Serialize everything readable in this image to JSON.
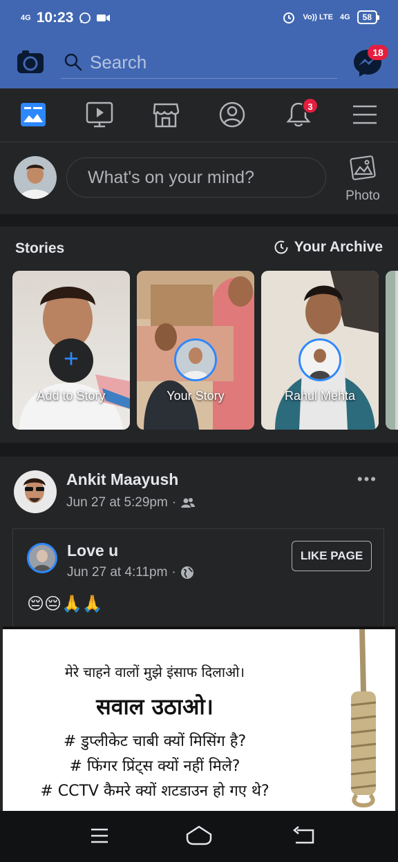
{
  "status_bar": {
    "network": "4G",
    "time": "10:23",
    "volte": "Vo)) LTE",
    "network2": "4G",
    "battery": "58"
  },
  "top_bar": {
    "search_placeholder": "Search",
    "messenger_badge": "18",
    "brand_color": "#4267b2"
  },
  "nav": {
    "items": [
      "news-feed",
      "watch",
      "marketplace",
      "profile",
      "notifications",
      "menu"
    ],
    "notifications_badge": "3"
  },
  "composer": {
    "prompt": "What's on your mind?",
    "photo_label": "Photo"
  },
  "stories": {
    "title": "Stories",
    "archive_label": "Your Archive",
    "items": [
      {
        "label": "Add to Story"
      },
      {
        "label": "Your Story"
      },
      {
        "label": "Rahul Mehta"
      }
    ]
  },
  "post": {
    "author": "Ankit Maayush",
    "timestamp": "Jun 27 at 5:29pm",
    "shared": {
      "page_name": "Love u",
      "timestamp": "Jun 27 at 4:11pm",
      "like_page_label": "LIKE PAGE",
      "text": "😔😔🙏🙏"
    },
    "image_text": {
      "line1": "मेरे चाहने वालों मुझे इंसाफ दिलाओ।",
      "line2": "सवाल उठाओ।",
      "line3": "# डुप्लीकेट चाबी क्यों मिसिंग है?",
      "line4": "# फिंगर प्रिंट्स क्यों नहीं मिले?",
      "line5": "# CCTV कैमरे क्यों शटडाउन हो गए थे?"
    }
  }
}
